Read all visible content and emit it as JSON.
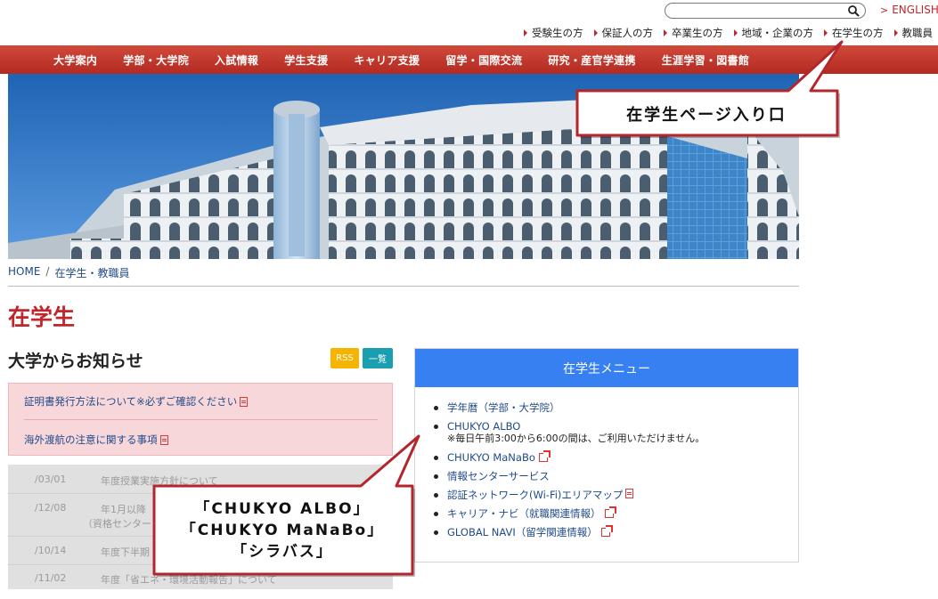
{
  "search": {
    "value": "",
    "placeholder": ""
  },
  "language_link": "ENGLISH",
  "audience_links": [
    "受験生の方",
    "保証人の方",
    "卒業生の方",
    "地域・企業の方",
    "在学生の方",
    "教職員"
  ],
  "main_nav": [
    "大学案内",
    "学部・大学院",
    "入試情報",
    "学生支援",
    "キャリア支援",
    "留学・国際交流",
    "研究・産官学連携",
    "生涯学習・図書館"
  ],
  "breadcrumb": {
    "home": "HOME",
    "separator": "/",
    "current": "在学生・教職員"
  },
  "page_title": "在学生",
  "news": {
    "heading": "大学からお知らせ",
    "rss_label": "RSS",
    "list_label": "一覧",
    "alerts": [
      "証明書発行方法について※必ずご確認ください",
      "海外渡航の注意に関する事項"
    ],
    "items": [
      {
        "date": "/03/01",
        "text": "年度授業実施方針について",
        "text2": ""
      },
      {
        "date": "/12/08",
        "text": "年1月以降",
        "text2": "（資格センター"
      },
      {
        "date": "/10/14",
        "text": "年度下半期",
        "text2": ""
      },
      {
        "date": "/11/02",
        "text": "年度「省エネ・環境活動報告」について",
        "text2": ""
      }
    ]
  },
  "student_menu": {
    "header": "在学生メニュー",
    "items": [
      {
        "label": "学年暦（学部・大学院）",
        "note": ""
      },
      {
        "label": "CHUKYO ALBO",
        "note": "※毎日午前3:00から6:00の間は、ご利用いただけません。"
      },
      {
        "label": "CHUKYO MaNaBo",
        "note": ""
      },
      {
        "label": "情報センターサービス",
        "note": ""
      },
      {
        "label": "認証ネットワーク(Wi-Fi)エリアマップ",
        "note": ""
      },
      {
        "label": "キャリア・ナビ（就職関連情報）",
        "note": ""
      },
      {
        "label": "GLOBAL NAVI（留学関連情報）",
        "note": ""
      }
    ]
  },
  "callouts": {
    "entrance": "在学生ページ入り口",
    "systems": [
      "「CHUKYO ALBO」",
      "「CHUKYO MaNaBo」",
      "「シラバス」"
    ]
  },
  "colors": {
    "brand_red": "#c0272d",
    "nav_red": "#b32a22",
    "menu_blue": "#3780f2",
    "rss_yellow": "#f4b400",
    "list_teal": "#1a9fb0",
    "alert_pink": "#f8d7da",
    "link_blue": "#1f4a8a",
    "callout_border": "#b3262b"
  }
}
